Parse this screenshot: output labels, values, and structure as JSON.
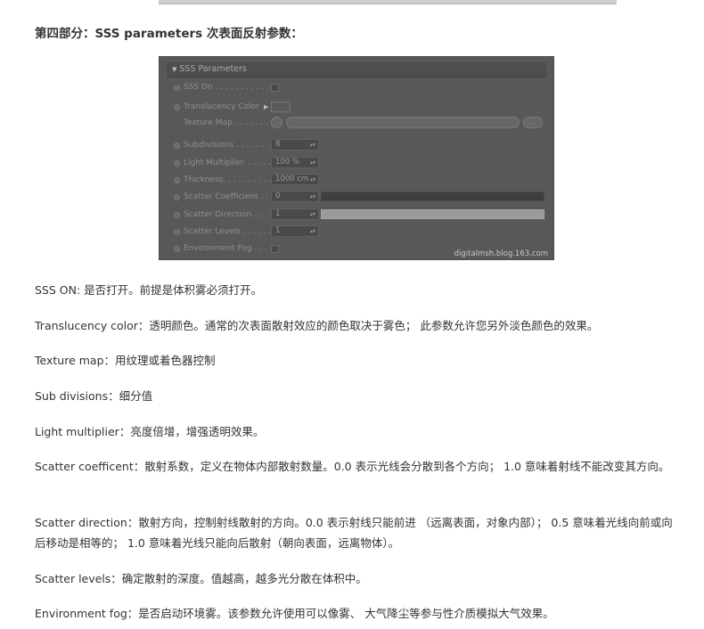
{
  "heading": "第四部分：SSS parameters 次表面反射参数：",
  "panel": {
    "title": "SSS Parameters",
    "rows": [
      {
        "label": "SSS On . . . . . . . . . . .",
        "kind": "checkbox"
      },
      {
        "label": "Translucency Color",
        "kind": "swatch"
      },
      {
        "label": "Texture Map . . . . . . .",
        "kind": "texture",
        "button": "..."
      },
      {
        "label": "Subdivisions . . . . . . . .",
        "kind": "field",
        "value": "8"
      },
      {
        "label": "Light Multiplier. . . . . .",
        "kind": "field",
        "value": "100 %"
      },
      {
        "label": "Thickness. . . . . . . . . . .",
        "kind": "field",
        "value": "1000 cm"
      },
      {
        "label": "Scatter Coefficient . . . .",
        "kind": "field-slider-dark",
        "value": "0"
      },
      {
        "label": "Scatter Direction. . . . . .",
        "kind": "field-slider-light",
        "value": "1"
      },
      {
        "label": "Scatter Levels . . . . . . .",
        "kind": "field",
        "value": "1"
      },
      {
        "label": "Environment Fog . . . . .",
        "kind": "checkbox"
      }
    ],
    "watermark": "digitalmsh.blog.163.com"
  },
  "paragraphs": [
    "SSS ON: 是否打开。前提是体积雾必须打开。",
    "Translucency color：透明颜色。通常的次表面散射效应的颜色取决于雾色； 此参数允许您另外淡色颜色的效果。",
    "Texture map：用纹理或着色器控制",
    "Sub divisions：细分值",
    "Light multiplier：亮度倍增，增强透明效果。",
    "Scatter coefficent：散射系数，定义在物体内部散射数量。0.0 表示光线会分散到各个方向； 1.0 意味着射线不能改变其方向。",
    "Scatter direction：散射方向，控制射线散射的方向。0.0 表示射线只能前进 （远离表面，对象内部）； 0.5 意味着光线向前或向后移动是相等的； 1.0 意味着光线只能向后散射（朝向表面，远离物体）。",
    "Scatter levels：确定散射的深度。值越高，越多光分散在体积中。",
    "Environment fog：是否启动环境雾。该参数允许使用可以像雾、 大气降尘等参与性介质模拟大气效果。"
  ]
}
